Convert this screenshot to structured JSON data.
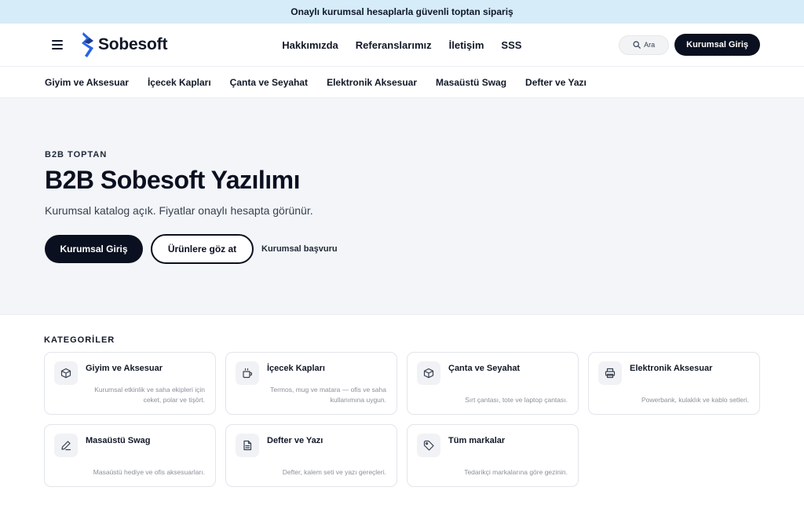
{
  "announcement": "Onaylı kurumsal hesaplarla güvenli toptan sipariş",
  "header": {
    "menu_icon": "hamburger-menu-icon",
    "logo_icon": "sobesoft-s-logo",
    "logo_text": "Sobesoft",
    "nav": [
      {
        "label": "Hakkımızda"
      },
      {
        "label": "Referanslarımız"
      },
      {
        "label": "İletişim"
      },
      {
        "label": "SSS"
      }
    ],
    "search_icon": "search-icon",
    "search_label": "Ara",
    "login_label": "Kurumsal Giriş"
  },
  "category_nav": [
    {
      "label": "Giyim ve Aksesuar"
    },
    {
      "label": "İçecek Kapları"
    },
    {
      "label": "Çanta ve Seyahat"
    },
    {
      "label": "Elektronik Aksesuar"
    },
    {
      "label": "Masaüstü Swag"
    },
    {
      "label": "Defter ve Yazı"
    }
  ],
  "hero": {
    "eyebrow": "B2B TOPTAN",
    "title": "B2B Sobesoft Yazılımı",
    "subtitle": "Kurumsal katalog açık. Fiyatlar onaylı hesapta görünür.",
    "primary_label": "Kurumsal Giriş",
    "secondary_label": "Ürünlere göz at",
    "link_label": "Kurumsal başvuru"
  },
  "categories": {
    "title": "KATEGORİLER",
    "items": [
      {
        "icon": "box-icon",
        "title": "Giyim ve Aksesuar",
        "desc": "Kurumsal etkinlik ve saha ekipleri için ceket, polar ve tişört."
      },
      {
        "icon": "cup-icon",
        "title": "İçecek Kapları",
        "desc": "Termos, mug ve matara — ofis ve saha kullanımına uygun."
      },
      {
        "icon": "box-icon",
        "title": "Çanta ve Seyahat",
        "desc": "Sırt çantası, tote ve laptop çantası."
      },
      {
        "icon": "printer-icon",
        "title": "Elektronik Aksesuar",
        "desc": "Powerbank, kulaklık ve kablo setleri."
      },
      {
        "icon": "pen-icon",
        "title": "Masaüstü Swag",
        "desc": "Masaüstü hediye ve ofis aksesuarları."
      },
      {
        "icon": "document-icon",
        "title": "Defter ve Yazı",
        "desc": "Defter, kalem seti ve yazı gereçleri."
      },
      {
        "icon": "tag-icon",
        "title": "Tüm markalar",
        "desc": "Tedarikçi markalarına göre gezinin."
      }
    ]
  },
  "colors": {
    "announcement_bg": "#d6ecf8",
    "hero_bg": "#f3f5f8",
    "primary_dark": "#0b1020",
    "logo_blue": "#2563eb"
  }
}
